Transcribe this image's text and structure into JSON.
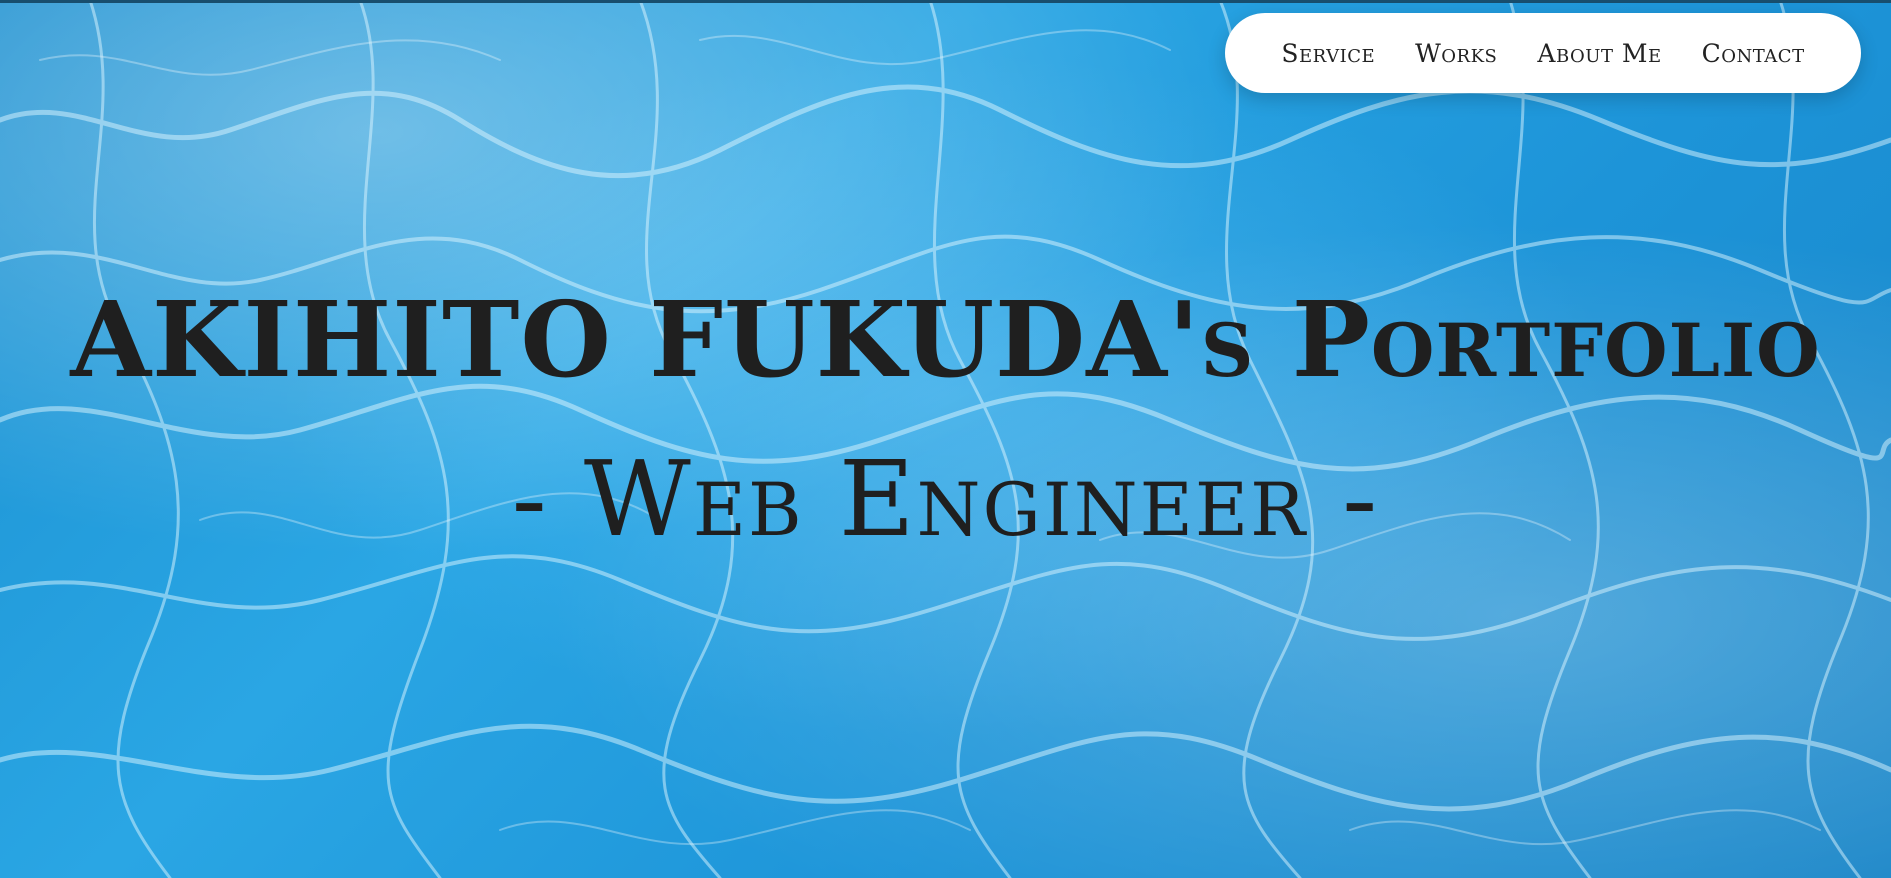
{
  "nav": {
    "items": [
      {
        "label": "Service"
      },
      {
        "label": "Works"
      },
      {
        "label": "About Me"
      },
      {
        "label": "Contact"
      }
    ]
  },
  "hero": {
    "title": "AKIHITO FUKUDA's Portfolio",
    "subtitle": "- Web Engineer -"
  },
  "colors": {
    "water_blue": "#1d94d8",
    "nav_background": "#ffffff",
    "text": "#1f1f1f"
  }
}
